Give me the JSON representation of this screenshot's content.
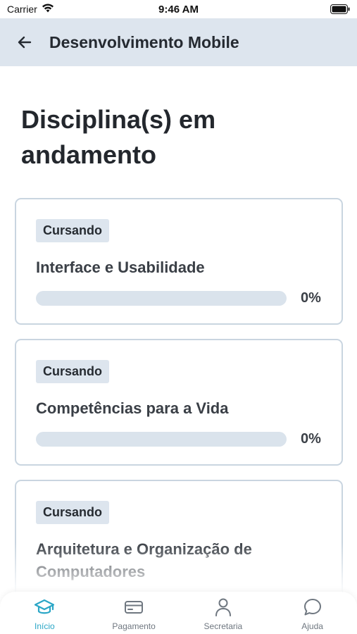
{
  "status": {
    "carrier": "Carrier",
    "time": "9:46 AM"
  },
  "header": {
    "title": "Desenvolvimento Mobile"
  },
  "page_title": "Disciplina(s) em andamento",
  "courses": [
    {
      "badge": "Cursando",
      "name": "Interface e Usabilidade",
      "progress_percent": 0,
      "progress_text": "0%"
    },
    {
      "badge": "Cursando",
      "name": "Competências para a Vida",
      "progress_percent": 0,
      "progress_text": "0%"
    },
    {
      "badge": "Cursando",
      "name": "Arquitetura e Organização de Computadores"
    }
  ],
  "nav": {
    "active": "inicio",
    "items": [
      {
        "id": "inicio",
        "label": "Início",
        "icon": "graduation-cap-icon"
      },
      {
        "id": "pagamento",
        "label": "Pagamento",
        "icon": "credit-card-icon"
      },
      {
        "id": "secretaria",
        "label": "Secretaria",
        "icon": "person-icon"
      },
      {
        "id": "ajuda",
        "label": "Ajuda",
        "icon": "chat-bubble-icon"
      }
    ]
  },
  "colors": {
    "accent": "#2aa6c6",
    "header_bg": "#dde5ee",
    "track": "#dae3ec",
    "card_border": "#c9d5e0"
  }
}
